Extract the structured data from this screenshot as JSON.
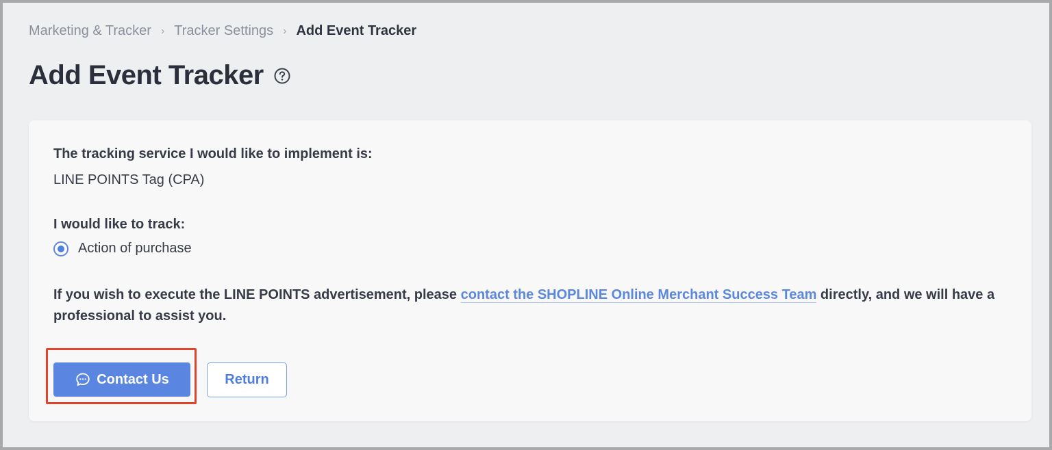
{
  "breadcrumb": {
    "items": [
      "Marketing & Tracker",
      "Tracker Settings"
    ],
    "current": "Add Event Tracker",
    "separator": "›"
  },
  "page": {
    "title": "Add Event Tracker",
    "help_icon": "question-circle-icon"
  },
  "form": {
    "service_label": "The tracking service I would like to implement is:",
    "service_value": "LINE POINTS Tag (CPA)",
    "track_label": "I would like to track:",
    "track_option": "Action of purchase",
    "track_selected": true,
    "note_before": "If you wish to execute the LINE POINTS advertisement, please ",
    "note_link": "contact the SHOPLINE Online Merchant Success Team",
    "note_after": " directly, and we will have a professional to assist you."
  },
  "actions": {
    "contact_label": "Contact Us",
    "contact_icon": "chat-bubble-icon",
    "return_label": "Return"
  },
  "colors": {
    "accent": "#5a86e2",
    "link": "#5b87dc",
    "highlight": "#e2442b",
    "background": "#eeeff1",
    "card": "#f8f8f9"
  }
}
